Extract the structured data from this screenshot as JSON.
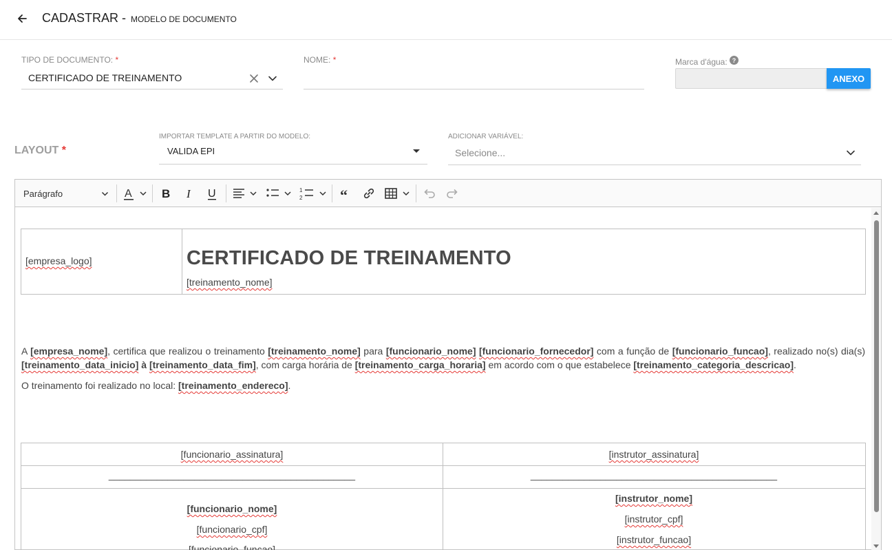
{
  "header": {
    "title": "CADASTRAR -",
    "subtitle": "MODELO DE DOCUMENTO"
  },
  "form": {
    "tipo_documento": {
      "label": "TIPO DE DOCUMENTO:",
      "required": "*",
      "value": "CERTIFICADO DE TREINAMENTO"
    },
    "nome": {
      "label": "NOME:",
      "required": "*",
      "value": ""
    },
    "marca_dagua": {
      "label": "Marca d'água:",
      "button": "ANEXO"
    },
    "layout": {
      "label": "LAYOUT",
      "required": "*"
    },
    "importar_template": {
      "label": "IMPORTAR TEMPLATE A PARTIR DO MODELO:",
      "value": "VALIDA EPI"
    },
    "adicionar_variavel": {
      "label": "ADICIONAR VARIÁVEL:",
      "placeholder": "Selecione..."
    }
  },
  "toolbar": {
    "paragraph_style": "Parágrafo",
    "buttons": [
      "font-color",
      "bold",
      "italic",
      "underline",
      "align",
      "bulleted-list",
      "numbered-list",
      "blockquote",
      "link",
      "table",
      "undo",
      "redo"
    ]
  },
  "document": {
    "logo_var": "[empresa_logo]",
    "heading": "CERTIFICADO DE TREINAMENTO",
    "training_name_var": "[treinamento_nome]",
    "p1": {
      "t1": "A ",
      "v1": "[empresa_nome]",
      "t2": ", certifica que realizou o treinamento ",
      "v2": "[treinamento_nome]",
      "t3": " para ",
      "v3": "[funcionario_nome]",
      "t4": " ",
      "v4": "[funcionario_fornecedor]",
      "t5": " com a função de ",
      "v5": "[funcionario_funcao]",
      "t6": ", realizado no(s) dia(s) ",
      "v6": "[treinamento_data_inicio]",
      "t7": " à ",
      "v7": "[treinamento_data_fim]",
      "t8": ", com carga horária de ",
      "v8": "[treinamento_carga_horaria]",
      "t9": " em acordo com o que estabelece ",
      "v9": "[treinamento_categoria_descricao]",
      "t10": "."
    },
    "p2": {
      "t1": "O treinamento foi realizado no local: ",
      "v1": "[treinamento_endereco]",
      "t2": "."
    },
    "signatures": {
      "left_sig": "[funcionario_assinatura]",
      "right_sig": "[instrutor_assinatura]",
      "line": "______________________________________________",
      "left_name": "[funcionario_nome]",
      "left_cpf": "[funcionario_cpf]",
      "left_role": "[funcionario_funcao]",
      "right_name": "[instrutor_nome]",
      "right_cpf": "[instrutor_cpf]",
      "right_role": "[instrutor_funcao]"
    }
  },
  "colors": {
    "accent": "#2196f3",
    "required": "#e53935",
    "spellcheck": "#e53935"
  }
}
